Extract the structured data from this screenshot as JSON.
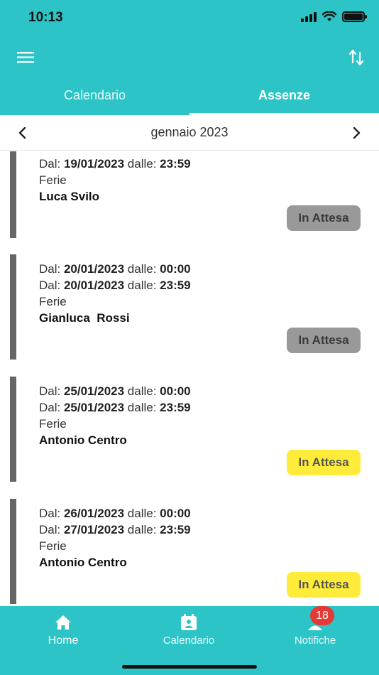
{
  "status_bar": {
    "time": "10:13"
  },
  "header": {
    "tabs": [
      {
        "label": "Calendario",
        "active": false
      },
      {
        "label": "Assenze",
        "active": true
      }
    ]
  },
  "month_nav": {
    "label": "gennaio 2023"
  },
  "absences": [
    {
      "lines": [
        {
          "prefix": "Dal: ",
          "date": "19/01/2023",
          "mid": " dalle: ",
          "time": "23:59"
        }
      ],
      "type": "Ferie",
      "name": "Luca Svilo",
      "status": "In Attesa",
      "status_color": "gray"
    },
    {
      "lines": [
        {
          "prefix": "Dal: ",
          "date": "20/01/2023",
          "mid": " dalle: ",
          "time": "00:00"
        },
        {
          "prefix": "Dal: ",
          "date": "20/01/2023",
          "mid": " dalle: ",
          "time": "23:59"
        }
      ],
      "type": "Ferie",
      "name": "Gianluca  Rossi",
      "status": "In Attesa",
      "status_color": "gray"
    },
    {
      "lines": [
        {
          "prefix": "Dal: ",
          "date": "25/01/2023",
          "mid": " dalle: ",
          "time": "00:00"
        },
        {
          "prefix": "Dal: ",
          "date": "25/01/2023",
          "mid": " dalle: ",
          "time": "23:59"
        }
      ],
      "type": "Ferie",
      "name": "Antonio Centro",
      "status": "In Attesa",
      "status_color": "yellow"
    },
    {
      "lines": [
        {
          "prefix": "Dal: ",
          "date": "26/01/2023",
          "mid": " dalle: ",
          "time": "00:00"
        },
        {
          "prefix": "Dal: ",
          "date": "27/01/2023",
          "mid": " dalle: ",
          "time": "23:59"
        }
      ],
      "type": "Ferie",
      "name": "Antonio Centro",
      "status": "In Attesa",
      "status_color": "yellow"
    }
  ],
  "bottom_nav": {
    "items": [
      {
        "label": "Home",
        "icon": "home-icon"
      },
      {
        "label": "Calendario",
        "icon": "calendar-person-icon"
      },
      {
        "label": "Notifiche",
        "icon": "user-icon"
      }
    ],
    "notification_count": "18"
  },
  "colors": {
    "accent": "#2cc4c6",
    "pending_gray": "#999999",
    "pending_yellow": "#ffec3a",
    "badge_red": "#e53935"
  }
}
